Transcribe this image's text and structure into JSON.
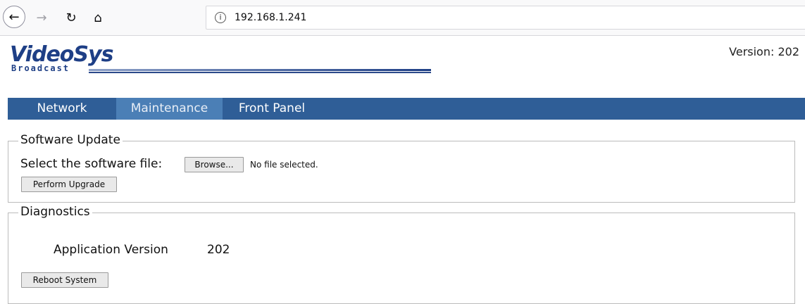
{
  "browser": {
    "url": "192.168.1.241",
    "info_icon_glyph": "i",
    "back_glyph": "←",
    "forward_glyph": "→",
    "reload_glyph": "↻",
    "home_glyph": "⌂"
  },
  "header": {
    "logo_main": "VideoSys",
    "logo_sub": "Broadcast",
    "version_label": "Version: 202"
  },
  "tabs": [
    {
      "label": "Network"
    },
    {
      "label": "Maintenance",
      "active": true
    },
    {
      "label": "Front Panel"
    }
  ],
  "software_update": {
    "legend": "Software Update",
    "select_label": "Select the software file:",
    "browse_label": "Browse...",
    "no_file": "No file selected.",
    "upgrade_label": "Perform Upgrade"
  },
  "diagnostics": {
    "legend": "Diagnostics",
    "app_version_label": "Application Version",
    "app_version_value": "202",
    "reboot_label": "Reboot System"
  },
  "colors": {
    "tab_bar": "#2f5e97",
    "tab_active": "#4b7fb6",
    "logo": "#1e3f86"
  }
}
